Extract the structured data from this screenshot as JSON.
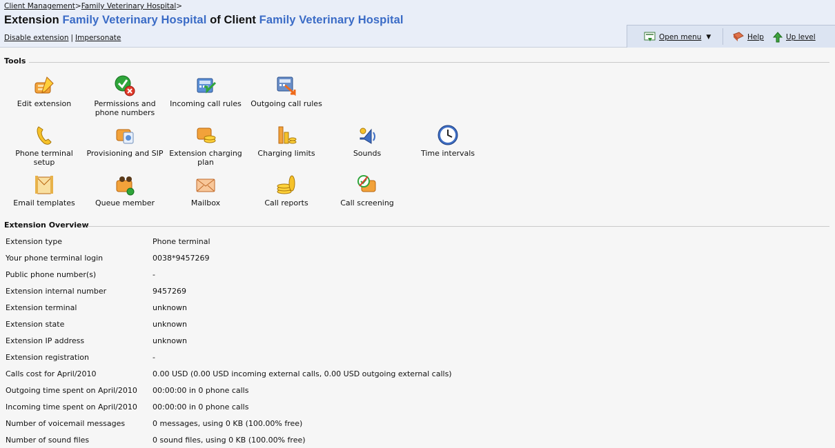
{
  "breadcrumb": {
    "item1": "Client Management",
    "sep1": ">",
    "item2": "Family Veterinary Hospital",
    "sep2": ">"
  },
  "title": {
    "prefix": "Extension",
    "extension_name": "Family Veterinary Hospital",
    "mid": "of Client",
    "client_name": "Family Veterinary Hospital"
  },
  "links": {
    "disable": "Disable extension",
    "separator": "|",
    "impersonate": "Impersonate"
  },
  "menubar": {
    "open_menu": "Open menu",
    "help": "Help",
    "up_level": "Up level"
  },
  "tools": {
    "heading": "Tools",
    "items": [
      {
        "label": "Edit extension",
        "icon": "edit-extension-icon"
      },
      {
        "label": "Permissions and phone numbers",
        "icon": "permissions-icon"
      },
      {
        "label": "Incoming call rules",
        "icon": "incoming-call-rules-icon"
      },
      {
        "label": "Outgoing call rules",
        "icon": "outgoing-call-rules-icon"
      },
      {
        "label": "Phone terminal setup",
        "icon": "phone-terminal-icon"
      },
      {
        "label": "Provisioning and SIP",
        "icon": "provisioning-icon"
      },
      {
        "label": "Extension charging plan",
        "icon": "charging-plan-icon"
      },
      {
        "label": "Charging limits",
        "icon": "charging-limits-icon"
      },
      {
        "label": "Sounds",
        "icon": "sounds-icon"
      },
      {
        "label": "Time intervals",
        "icon": "clock-icon"
      },
      {
        "label": "Email templates",
        "icon": "email-templates-icon"
      },
      {
        "label": "Queue member",
        "icon": "queue-member-icon"
      },
      {
        "label": "Mailbox",
        "icon": "mailbox-icon"
      },
      {
        "label": "Call reports",
        "icon": "call-reports-icon"
      },
      {
        "label": "Call screening",
        "icon": "call-screening-icon"
      }
    ]
  },
  "overview": {
    "heading": "Extension Overview",
    "rows": [
      {
        "key": "Extension type",
        "value": "Phone terminal"
      },
      {
        "key": "Your phone terminal login",
        "value": "0038*9457269"
      },
      {
        "key": "Public phone number(s)",
        "value": "-"
      },
      {
        "key": "Extension internal number",
        "value": "9457269"
      },
      {
        "key": "Extension terminal",
        "value": "unknown"
      },
      {
        "key": "Extension state",
        "value": "unknown"
      },
      {
        "key": "Extension IP address",
        "value": "unknown"
      },
      {
        "key": "Extension registration",
        "value": "-"
      },
      {
        "key": "Calls cost for April/2010",
        "value": "0.00 USD (0.00 USD incoming external calls, 0.00 USD outgoing external calls)"
      },
      {
        "key": "Outgoing time spent on April/2010",
        "value": "00:00:00 in 0 phone calls"
      },
      {
        "key": "Incoming time spent on April/2010",
        "value": "00:00:00 in 0 phone calls"
      },
      {
        "key": "Number of voicemail messages",
        "value": "0 messages, using 0 KB (100.00% free)"
      },
      {
        "key": "Number of sound files",
        "value": "0 sound files, using 0 KB (100.00% free)"
      }
    ]
  }
}
